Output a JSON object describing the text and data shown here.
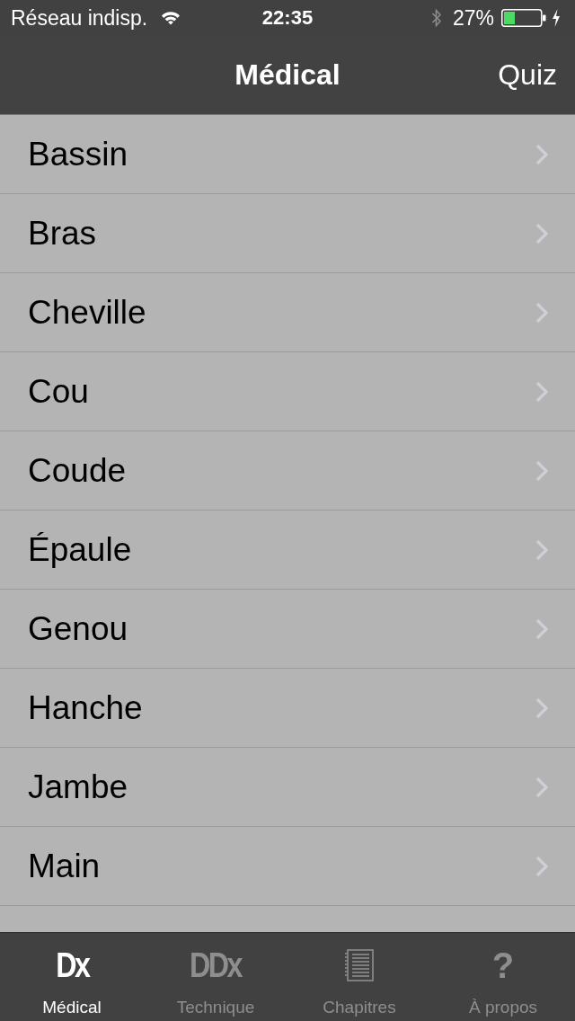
{
  "status_bar": {
    "carrier": "Réseau indisp.",
    "time": "22:35",
    "battery": "27%"
  },
  "nav_bar": {
    "title": "Médical",
    "right_button": "Quiz"
  },
  "list": {
    "items": [
      {
        "label": "Bassin"
      },
      {
        "label": "Bras"
      },
      {
        "label": "Cheville"
      },
      {
        "label": "Cou"
      },
      {
        "label": "Coude"
      },
      {
        "label": "Épaule"
      },
      {
        "label": "Genou"
      },
      {
        "label": "Hanche"
      },
      {
        "label": "Jambe"
      },
      {
        "label": "Main"
      }
    ]
  },
  "tab_bar": {
    "tabs": [
      {
        "label": "Médical",
        "selected": true,
        "kind": "glyph",
        "glyph": "Dx"
      },
      {
        "label": "Technique",
        "selected": false,
        "kind": "glyph",
        "glyph": "DDx"
      },
      {
        "label": "Chapitres",
        "selected": false,
        "kind": "notebook"
      },
      {
        "label": "À propos",
        "selected": false,
        "kind": "glyph",
        "glyph": "?"
      }
    ]
  }
}
